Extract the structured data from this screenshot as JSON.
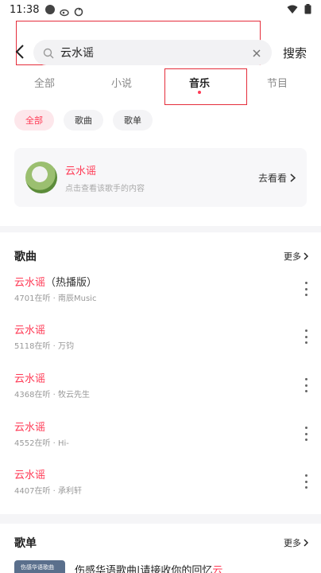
{
  "status_bar": {
    "time": "11:38"
  },
  "search": {
    "value": "云水谣",
    "button_label": "搜索"
  },
  "tabs": [
    {
      "label": "全部"
    },
    {
      "label": "小说"
    },
    {
      "label": "音乐"
    },
    {
      "label": "节目"
    }
  ],
  "filters": [
    {
      "label": "全部"
    },
    {
      "label": "歌曲"
    },
    {
      "label": "歌单"
    }
  ],
  "singer": {
    "name": "云水谣",
    "subtitle": "点击查看该歌手的内容",
    "action": "去看看"
  },
  "songs_section": {
    "title": "歌曲",
    "more": "更多",
    "items": [
      {
        "title": "云水谣",
        "suffix": "（热播版）",
        "meta": "4701在听 · 南辰Music"
      },
      {
        "title": "云水谣",
        "suffix": "",
        "meta": "5118在听 · 万钧"
      },
      {
        "title": "云水谣",
        "suffix": "",
        "meta": "4368在听 · 牧云先生"
      },
      {
        "title": "云水谣",
        "suffix": "",
        "meta": "4552在听 · Hi-"
      },
      {
        "title": "云水谣",
        "suffix": "",
        "meta": "4407在听 · 承利轩"
      }
    ]
  },
  "playlist_section": {
    "title": "歌单",
    "more": "更多",
    "first_item": {
      "cover_text": "伤感华语歌曲",
      "title": "伤感华语歌曲|请接收你的回忆",
      "title_highlight": "云"
    }
  },
  "colors": {
    "accent": "#ff3a55",
    "highlight_box": "#e52d3b"
  }
}
